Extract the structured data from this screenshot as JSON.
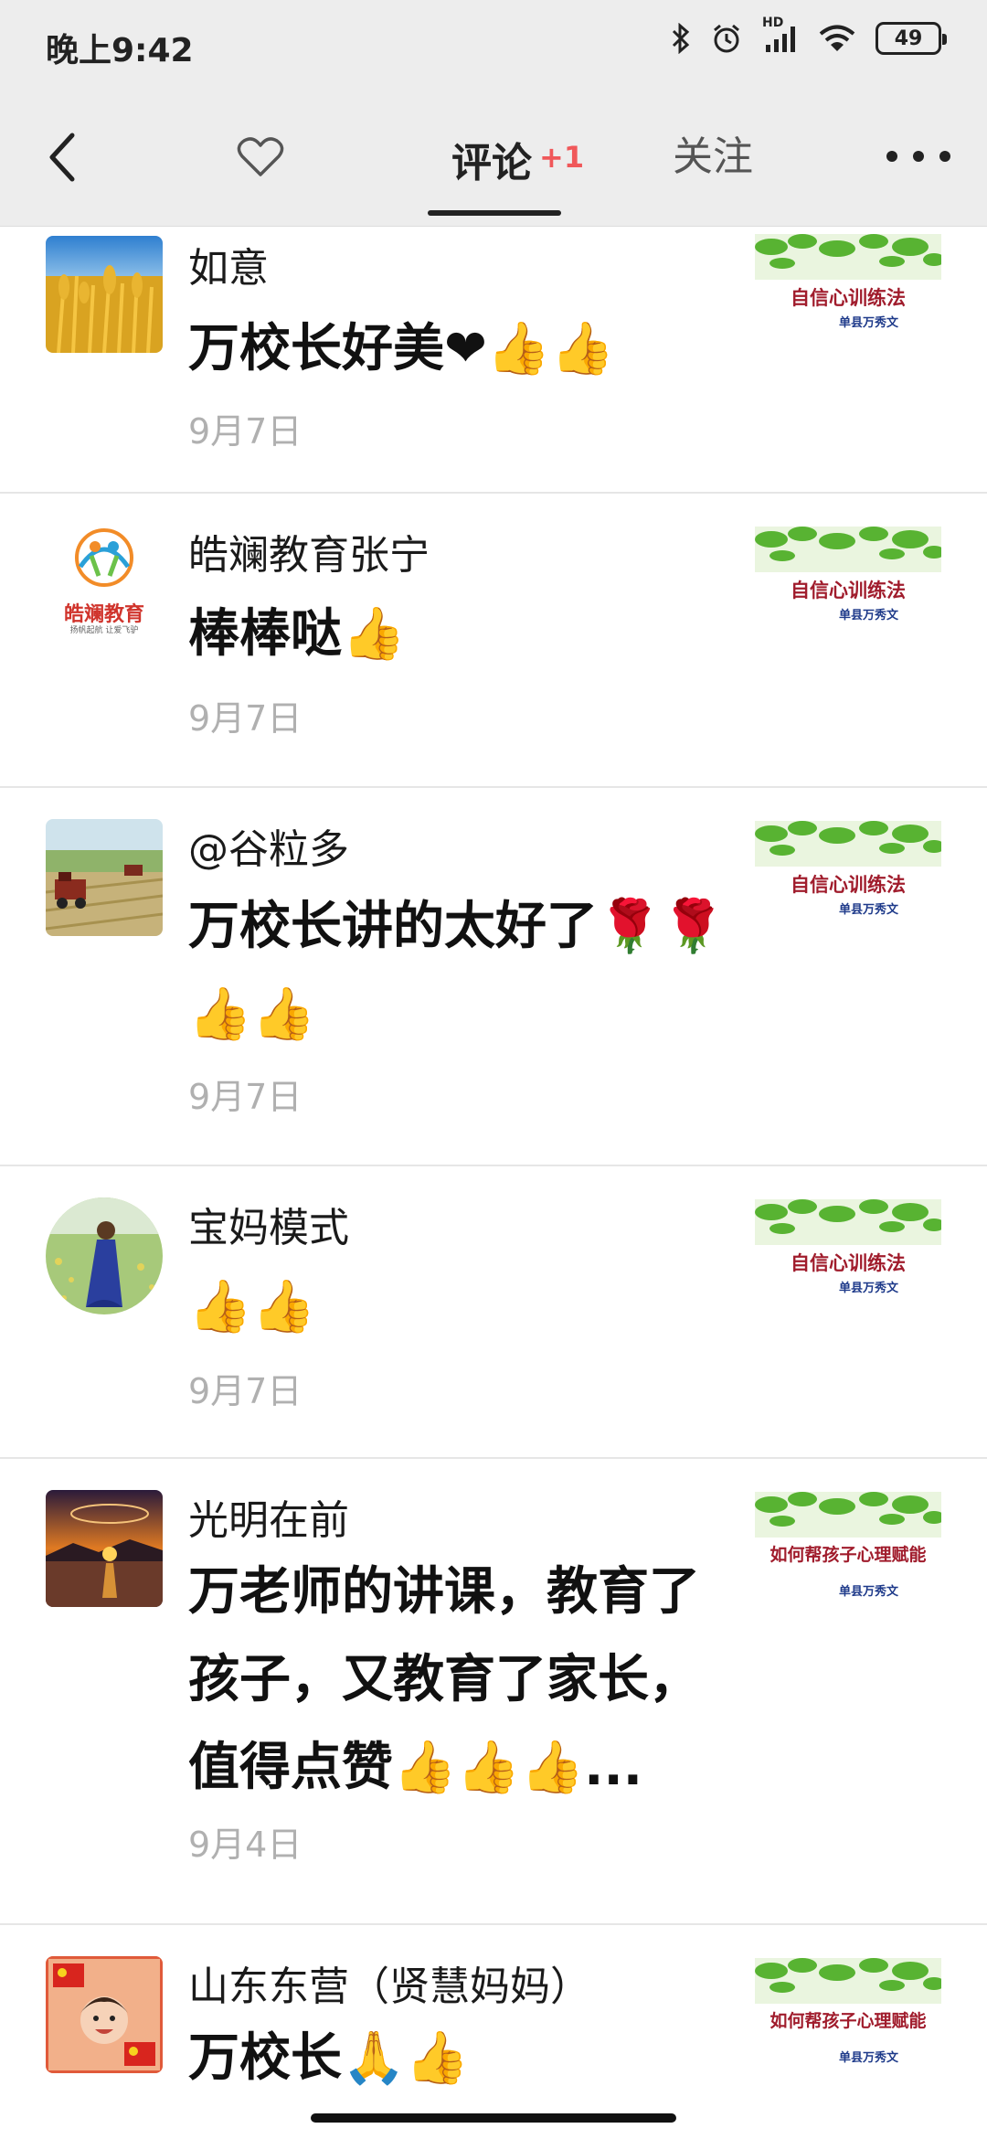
{
  "status_bar": {
    "time": "晚上9:42",
    "battery": "49",
    "network_label": "HD",
    "icons": [
      "bluetooth-icon",
      "alarm-icon",
      "signal-icon",
      "wifi-icon",
      "battery-icon"
    ]
  },
  "nav": {
    "back_icon": "chevron-left-icon",
    "like_icon": "heart-outline-icon",
    "tab_comments": "评论",
    "tab_comments_badge": "+1",
    "tab_follow": "关注",
    "more_icon": "more-dots-icon"
  },
  "comments": [
    {
      "name": "如意",
      "text": "万校长好美❤👍👍",
      "date": "9月7日",
      "thumb_title": "自信心训练法",
      "thumb_author": "单县万秀文"
    },
    {
      "name": "皓斓教育张宁",
      "text": "棒棒哒👍",
      "date": "9月7日",
      "avatar_text": "皓斓教育",
      "avatar_subtext": "扬帆起航 让爱飞驴",
      "thumb_title": "自信心训练法",
      "thumb_author": "单县万秀文"
    },
    {
      "name": "@谷粒多",
      "text": "万校长讲的太好了🌹🌹👍👍",
      "date": "9月7日",
      "thumb_title": "自信心训练法",
      "thumb_author": "单县万秀文"
    },
    {
      "name": "宝妈模式",
      "text": "👍👍",
      "date": "9月7日",
      "thumb_title": "自信心训练法",
      "thumb_author": "单县万秀文"
    },
    {
      "name": "光明在前",
      "text": "万老师的讲课，教育了孩子，又教育了家长，值得点赞👍👍👍...",
      "date": "9月4日",
      "thumb_title": "如何帮孩子心理赋能",
      "thumb_author": "单县万秀文"
    },
    {
      "name": "山东东营（贤慧妈妈）",
      "text": "万校长🙏👍",
      "date": "",
      "thumb_title": "如何帮孩子心理赋能",
      "thumb_author": "单县万秀文"
    }
  ],
  "colors": {
    "bar_bg": "#ededed",
    "badge": "#f0585a",
    "thumb_title": "#a01c2c",
    "thumb_author": "#1e3a8a",
    "date": "#b0b0b0"
  }
}
